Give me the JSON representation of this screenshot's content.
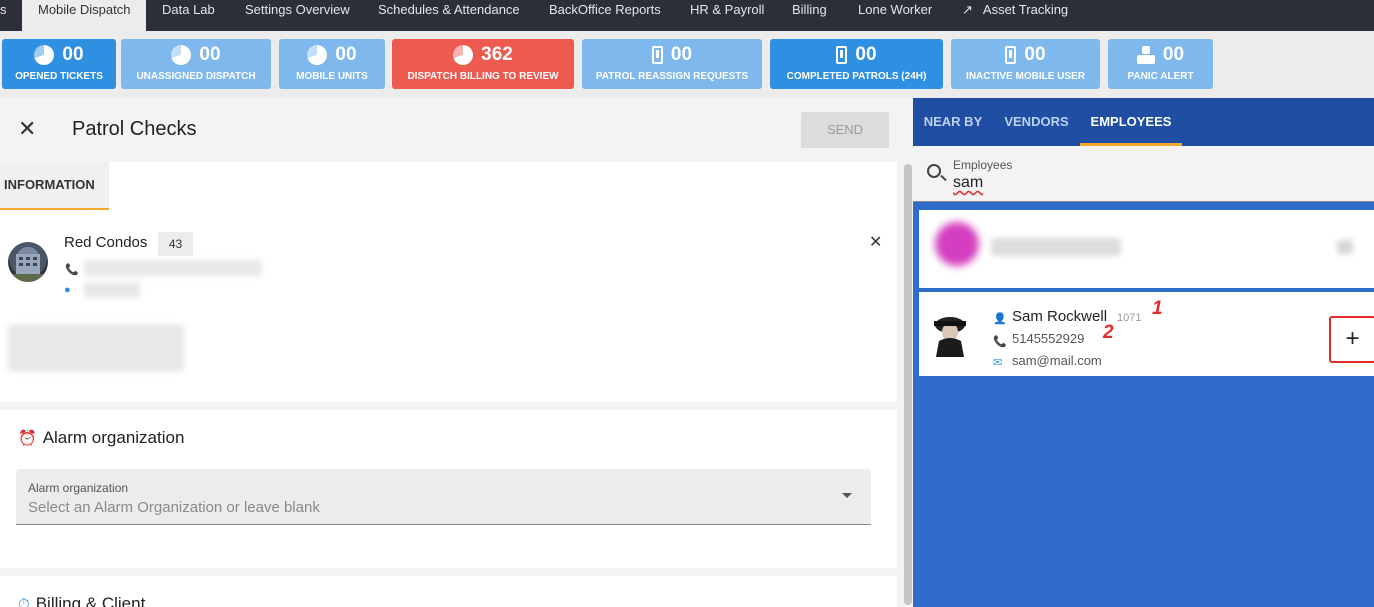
{
  "topnav": {
    "tabs": [
      {
        "label": "s"
      },
      {
        "label": "Mobile Dispatch",
        "active": true
      },
      {
        "label": "Data Lab"
      },
      {
        "label": "Settings Overview"
      },
      {
        "label": "Schedules & Attendance"
      },
      {
        "label": "BackOffice Reports"
      },
      {
        "label": "HR & Payroll"
      },
      {
        "label": "Billing"
      },
      {
        "label": "Lone Worker"
      },
      {
        "label": "Asset Tracking"
      }
    ]
  },
  "stats": [
    {
      "value": "00",
      "label": "OPENED TICKETS",
      "icon": "pie-chart-icon",
      "color": "#2f8fe0"
    },
    {
      "value": "00",
      "label": "UNASSIGNED DISPATCH",
      "icon": "pie-chart-icon",
      "color": "#7fb8ec"
    },
    {
      "value": "00",
      "label": "MOBILE UNITS",
      "icon": "pie-chart-icon",
      "color": "#7fb8ec"
    },
    {
      "value": "362",
      "label": "DISPATCH BILLING TO REVIEW",
      "icon": "pie-chart-icon",
      "color": "#ee5a4f"
    },
    {
      "value": "00",
      "label": "PATROL REASSIGN REQUESTS",
      "icon": "mobile-phone-icon",
      "color": "#7fb8ec"
    },
    {
      "value": "00",
      "label": "COMPLETED PATROLS (24H)",
      "icon": "mobile-phone-icon",
      "color": "#2f8fe0"
    },
    {
      "value": "00",
      "label": "INACTIVE MOBILE USER",
      "icon": "mobile-phone-icon",
      "color": "#7fb8ec"
    },
    {
      "value": "00",
      "label": "PANIC ALERT",
      "icon": "panic-icon",
      "color": "#7fb8ec"
    }
  ],
  "patrol": {
    "title": "Patrol Checks",
    "send_label": "SEND",
    "tab_label": "INFORMATION",
    "client_name": "Red Condos",
    "client_badge": "43",
    "alarm_section_title": "Alarm organization",
    "alarm_field_label": "Alarm organization",
    "alarm_field_placeholder": "Select an Alarm Organization or leave blank",
    "billing_section_title": "Billing & Client"
  },
  "employees_panel": {
    "tabs": [
      "NEAR BY",
      "VENDORS",
      "EMPLOYEES"
    ],
    "active_tab": "EMPLOYEES",
    "search_label": "Employees",
    "search_value": "sam",
    "result": {
      "name": "Sam Rockwell",
      "id": "1071",
      "phone": "5145552929",
      "email": "sam@mail.com",
      "add_label": "+"
    },
    "annotations": [
      "1",
      "2"
    ]
  }
}
